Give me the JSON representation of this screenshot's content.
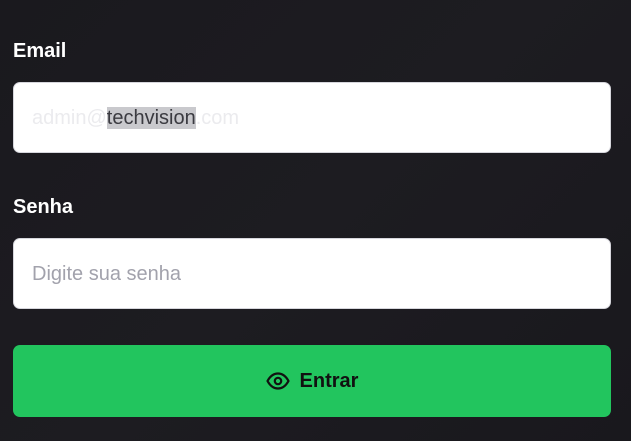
{
  "form": {
    "email": {
      "label": "Email",
      "value_prefix": "admin@",
      "value_selected": "techvision",
      "value_suffix": ".com"
    },
    "password": {
      "label": "Senha",
      "placeholder": "Digite sua senha"
    },
    "submit": {
      "label": "Entrar",
      "icon": "eye-icon"
    }
  },
  "colors": {
    "background": "#1c1b20",
    "input_background": "#ffffff",
    "button_background": "#22c55e",
    "label_text": "#ffffff",
    "placeholder_text": "#a2a2ac"
  }
}
